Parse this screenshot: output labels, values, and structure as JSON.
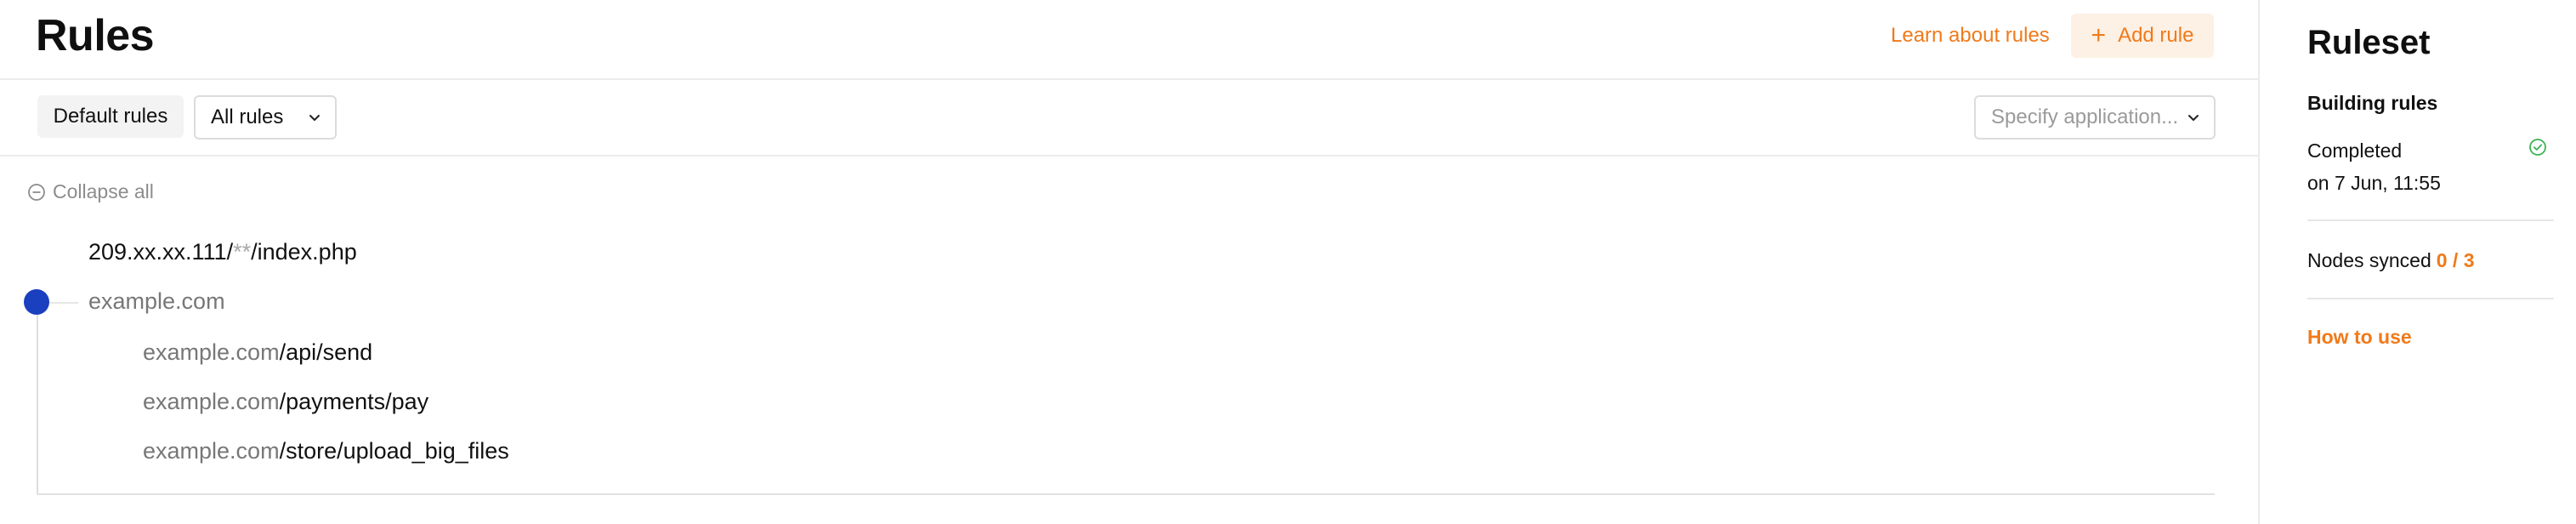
{
  "header": {
    "title": "Rules",
    "learn_link": "Learn about rules",
    "add_rule_label": "Add rule"
  },
  "toolbar": {
    "default_rules_label": "Default rules",
    "all_rules_select": "All rules",
    "application_placeholder": "Specify application..."
  },
  "tree": {
    "collapse_all_label": "Collapse all",
    "rows": [
      {
        "host": "209.xx.xx.111/",
        "wildcard": "**",
        "path": "/index.php"
      },
      {
        "host": "example.com",
        "wildcard": "",
        "path": ""
      },
      {
        "host": "example.com",
        "wildcard": "",
        "path": "/api/send"
      },
      {
        "host": "example.com",
        "wildcard": "",
        "path": "/payments/pay"
      },
      {
        "host": "example.com",
        "wildcard": "",
        "path": "/store/upload_big_files"
      }
    ]
  },
  "side_panel": {
    "title": "Ruleset",
    "building_rules_title": "Building rules",
    "status": "Completed",
    "status_date": "on 7 Jun, 11:55",
    "nodes_synced_label": "Nodes synced",
    "nodes_synced_count": "0 / 3",
    "how_to_use_label": "How to use"
  },
  "colors": {
    "accent": "#f07a1a",
    "accent_bg": "#fdf0e4",
    "tree_dot": "#1a3fbf",
    "success": "#3cb454"
  },
  "icons": {
    "add": "plus-icon",
    "select": "chevron-down-icon",
    "collapse": "minus-circle-icon",
    "status": "check-circle-icon"
  }
}
